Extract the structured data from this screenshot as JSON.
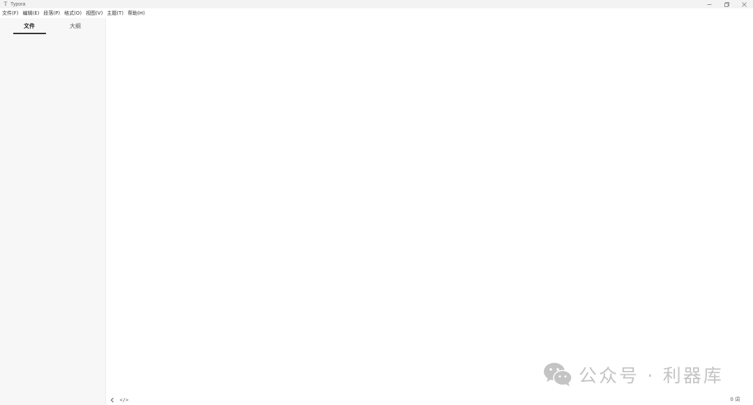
{
  "window": {
    "title": "Typora",
    "app_icon_glyph": "T",
    "controls": {
      "minimize_icon": "minimize-icon",
      "restore_icon": "restore-icon",
      "close_icon": "close-icon"
    }
  },
  "menubar": {
    "items": [
      {
        "label": "文件(F)"
      },
      {
        "label": "编辑(E)"
      },
      {
        "label": "段落(P)"
      },
      {
        "label": "格式(O)"
      },
      {
        "label": "视图(V)"
      },
      {
        "label": "主题(T)"
      },
      {
        "label": "帮助(H)"
      }
    ]
  },
  "sidebar": {
    "tabs": [
      {
        "label": "文件",
        "active": true
      },
      {
        "label": "大纲",
        "active": false
      }
    ]
  },
  "editor": {
    "content": ""
  },
  "footer": {
    "back_icon": "chevron-left-icon",
    "source_label": "</>",
    "word_count": "0 词"
  },
  "watermark": {
    "text": "公众号 · 利器库",
    "logo_icon": "wechat-icon"
  },
  "colors": {
    "titlebar_bg": "#f3f3f3",
    "sidebar_bg": "#f7f7f7",
    "editor_bg": "#ffffff",
    "active_tab_underline": "#333333",
    "watermark": "#c4c4c4"
  }
}
